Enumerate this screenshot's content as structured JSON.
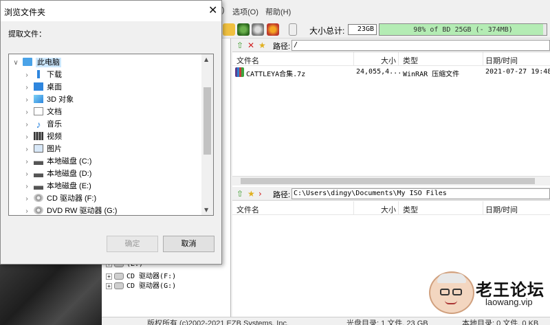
{
  "dialog": {
    "title": "浏览文件夹",
    "close_glyph": "✕",
    "label": "提取文件：",
    "tree": [
      {
        "label": "此电脑",
        "icon": "computer-icon",
        "expanded": true
      },
      {
        "label": "下载",
        "icon": "download-folder-icon"
      },
      {
        "label": "桌面",
        "icon": "desktop-folder-icon"
      },
      {
        "label": "3D 对象",
        "icon": "3d-objects-folder-icon"
      },
      {
        "label": "文档",
        "icon": "documents-folder-icon"
      },
      {
        "label": "音乐",
        "icon": "music-folder-icon"
      },
      {
        "label": "视频",
        "icon": "videos-folder-icon"
      },
      {
        "label": "图片",
        "icon": "pictures-folder-icon"
      },
      {
        "label": "本地磁盘 (C:)",
        "icon": "hard-drive-icon"
      },
      {
        "label": "本地磁盘 (D:)",
        "icon": "hard-drive-icon"
      },
      {
        "label": "本地磁盘 (E:)",
        "icon": "hard-drive-icon"
      },
      {
        "label": "CD 驱动器 (F:)",
        "icon": "cd-drive-icon"
      },
      {
        "label": "DVD RW 驱动器 (G:)",
        "icon": "dvd-drive-icon"
      }
    ],
    "ok_label": "确定",
    "cancel_label": "取消"
  },
  "app": {
    "menu": {
      "options": "选项(O)",
      "help": "帮助(H)",
      "partial": "F)"
    },
    "toolbar": {
      "total_label": "大小总计:",
      "total_value": "23GB",
      "progress_text": "98% of BD 25GB (- 374MB)",
      "progress_fraction": 0.98
    },
    "top_pane": {
      "path_label": "路径:",
      "path_value": "/",
      "columns": [
        "文件名",
        "大小",
        "类型",
        "日期/时间"
      ],
      "files": [
        {
          "name": "CATTLEYA合集.7z",
          "size": "24,055,4...",
          "type": "WinRAR 压缩文件",
          "date": "2021-07-27 19:48"
        }
      ]
    },
    "bottom_pane": {
      "path_label": "路径:",
      "path_value": "C:\\Users\\dingy\\Documents\\My ISO Files",
      "columns": [
        "文件名",
        "大小",
        "类型",
        "日期/时间"
      ]
    },
    "left_tree": {
      "items": [
        "(E:)",
        "CD 驱动器(F:)",
        "CD 驱动器(G:)"
      ]
    },
    "status": {
      "copyright": "版权所有 (c)2002-2021 EZB Systems, Inc.",
      "disc_dir": "光盘目录: 1 文件, 23 GB",
      "local_dir": "本地目录: 0 文件, 0 KB"
    }
  },
  "watermark": {
    "title": "老王论坛",
    "url": "laowang.vip"
  },
  "colors": {
    "progress_fill": "#b4ecb4",
    "selection": "#cce8ff"
  }
}
